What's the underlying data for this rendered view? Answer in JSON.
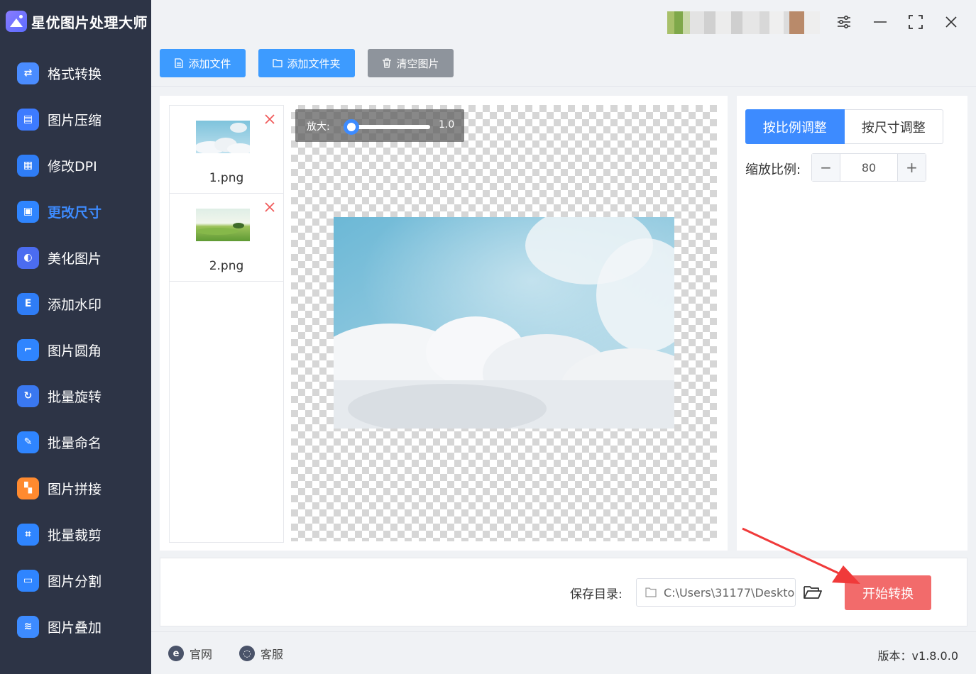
{
  "app": {
    "title": "星优图片处理大师"
  },
  "sidebar": {
    "items": [
      {
        "label": "格式转换",
        "icon": "format-convert-icon",
        "color": "#4a8cff",
        "active": false
      },
      {
        "label": "图片压缩",
        "icon": "compress-icon",
        "color": "#3d7bff",
        "active": false
      },
      {
        "label": "修改DPI",
        "icon": "dpi-icon",
        "color": "#2f7df6",
        "active": false
      },
      {
        "label": "更改尺寸",
        "icon": "resize-icon",
        "color": "#2f85ff",
        "active": true
      },
      {
        "label": "美化图片",
        "icon": "beautify-icon",
        "color": "#4b6cf0",
        "active": false
      },
      {
        "label": "添加水印",
        "icon": "watermark-icon",
        "color": "#2f7df6",
        "active": false
      },
      {
        "label": "图片圆角",
        "icon": "round-corner-icon",
        "color": "#2f85ff",
        "active": false
      },
      {
        "label": "批量旋转",
        "icon": "rotate-icon",
        "color": "#3a78f0",
        "active": false
      },
      {
        "label": "批量命名",
        "icon": "rename-icon",
        "color": "#2f85ff",
        "active": false
      },
      {
        "label": "图片拼接",
        "icon": "puzzle-icon",
        "color": "#ff8a2f",
        "active": false
      },
      {
        "label": "批量裁剪",
        "icon": "crop-icon",
        "color": "#2f85ff",
        "active": false
      },
      {
        "label": "图片分割",
        "icon": "split-icon",
        "color": "#2f85ff",
        "active": false
      },
      {
        "label": "图片叠加",
        "icon": "layers-icon",
        "color": "#3d8bff",
        "active": false
      }
    ]
  },
  "toolbar": {
    "add_file": "添加文件",
    "add_folder": "添加文件夹",
    "clear": "清空图片"
  },
  "files": [
    {
      "name": "1.png",
      "thumb": "sky-clouds"
    },
    {
      "name": "2.png",
      "thumb": "green-meadow"
    }
  ],
  "preview": {
    "zoom_label": "放大:",
    "zoom_value": "1.0"
  },
  "settings": {
    "tab_ratio": "按比例调整",
    "tab_size": "按尺寸调整",
    "scale_label": "缩放比例:",
    "scale_value": "80"
  },
  "output": {
    "save_label": "保存目录:",
    "save_path": "C:\\Users\\31177\\Deskto",
    "start_button": "开始转换"
  },
  "footer": {
    "website": "官网",
    "support": "客服",
    "version": "版本：v1.8.0.0"
  },
  "colors": {
    "sidebar_bg": "#2d3446",
    "accent": "#3d8bff",
    "start_button": "#f26b6b",
    "clear_button": "#8e949c"
  }
}
